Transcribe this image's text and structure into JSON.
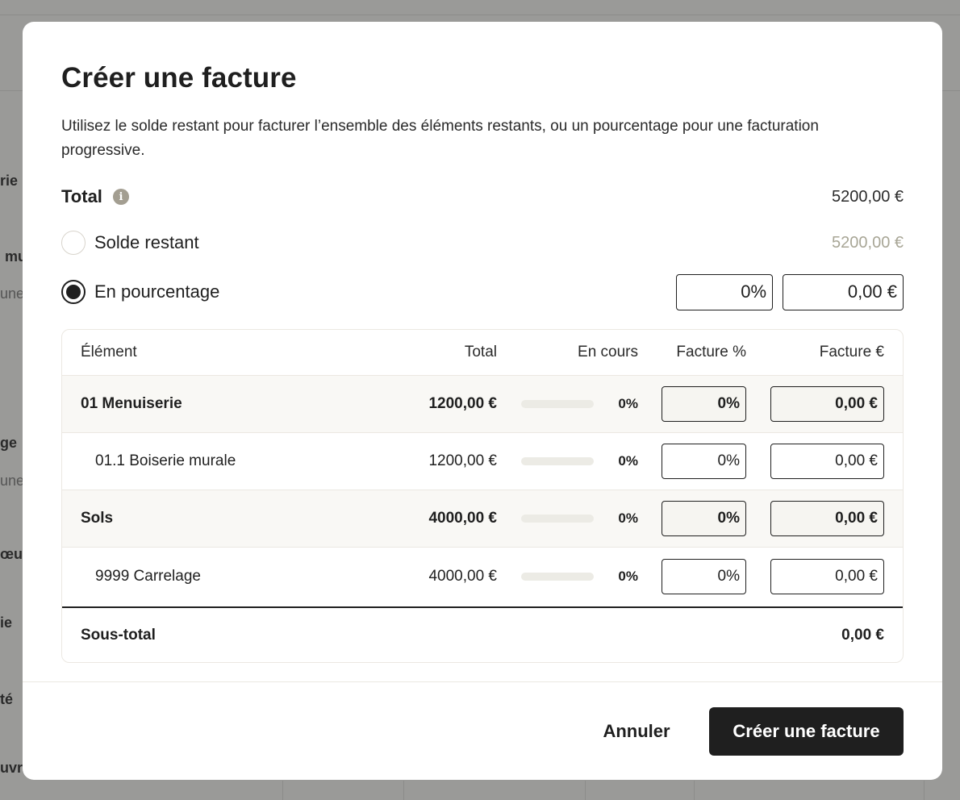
{
  "background": {
    "fragments": [
      "rie",
      "mu",
      "une",
      "ge",
      "une",
      "œu",
      "ie",
      "té",
      "uvre"
    ]
  },
  "dialog": {
    "title": "Créer une facture",
    "description": "Utilisez le solde restant pour facturer l’ensemble des éléments restants, ou un pourcentage pour une facturation progressive.",
    "total": {
      "label": "Total",
      "value": "5200,00 €"
    },
    "options": {
      "remaining": {
        "label": "Solde restant",
        "value": "5200,00 €",
        "selected": false
      },
      "percentage": {
        "label": "En pourcentage",
        "selected": true,
        "percent_value": "0%",
        "amount_value": "0,00 €"
      }
    },
    "table": {
      "headers": {
        "element": "Élément",
        "total": "Total",
        "in_progress": "En cours",
        "invoice_pct": "Facture %",
        "invoice_eur": "Facture €"
      },
      "rows": [
        {
          "name": "01 Menuiserie",
          "total": "1200,00 €",
          "progress_text": "0%",
          "progress": 0,
          "invoice_pct": "0%",
          "invoice_eur": "0,00 €",
          "group": true
        },
        {
          "name": "01.1 Boiserie murale",
          "total": "1200,00 €",
          "progress_text": "0%",
          "progress": 0,
          "invoice_pct": "0%",
          "invoice_eur": "0,00 €",
          "group": false
        },
        {
          "name": "Sols",
          "total": "4000,00 €",
          "progress_text": "0%",
          "progress": 0,
          "invoice_pct": "0%",
          "invoice_eur": "0,00 €",
          "group": true
        },
        {
          "name": "9999 Carrelage",
          "total": "4000,00 €",
          "progress_text": "0%",
          "progress": 0,
          "invoice_pct": "0%",
          "invoice_eur": "0,00 €",
          "group": false
        }
      ],
      "subtotal": {
        "label": "Sous-total",
        "value": "0,00 €"
      }
    },
    "buttons": {
      "cancel": "Annuler",
      "create": "Créer une facture"
    },
    "colors": {
      "primary": "#1f1f1f",
      "muted": "#a8a696",
      "group_bg": "#f9f8f5",
      "info_icon": "#a39e91"
    }
  }
}
